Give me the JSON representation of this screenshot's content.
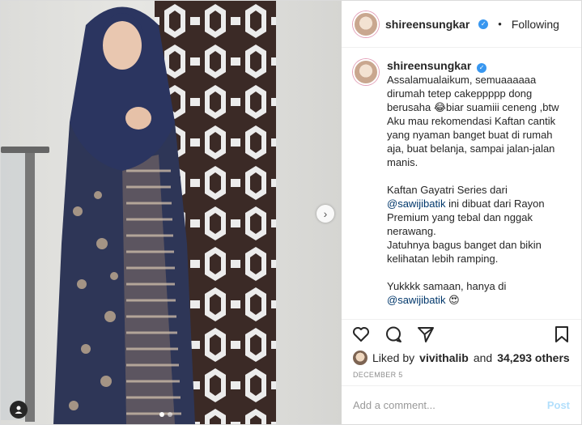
{
  "header": {
    "username": "shireensungkar",
    "follow_status": "Following",
    "separator": "•"
  },
  "caption": {
    "username": "shireensungkar",
    "paragraphs": [
      "Assalamualaikum, semuaaaaaa dirumah tetep cakeppppp dong berusaha 😂biar suamiii ceneng ,btw Aku mau rekomendasi Kaftan cantik yang nyaman banget buat di rumah aja, buat belanja, sampai jalan-jalan manis."
    ],
    "para2_pre": "Kaftan Gayatri Series dari",
    "para2_mention": "@sawijibatik",
    "para2_post": " ini dibuat dari Rayon Premium yang tebal dan nggak nerawang.",
    "para3": "Jatuhnya bagus banget dan bikin kelihatan lebih ramping.",
    "para4_pre": "Yukkkk samaan, hanya di",
    "para4_mention": "@sawijibatik",
    "para4_emoji": "😍"
  },
  "likes": {
    "prefix": "Liked by",
    "user": "vivithalib",
    "middle": "and",
    "count": "34,293 others"
  },
  "date": "DECEMBER 5",
  "comment": {
    "placeholder": "Add a comment...",
    "post_label": "Post"
  },
  "icons": [
    "heart-icon",
    "comment-icon",
    "share-icon",
    "bookmark-icon",
    "chevron-right-icon",
    "tagged-user-icon"
  ],
  "colors": {
    "verified": "#3897f0",
    "mention": "#00376b",
    "post_disabled": "#b2dffc"
  },
  "carousel": {
    "total": 2,
    "active": 1
  }
}
